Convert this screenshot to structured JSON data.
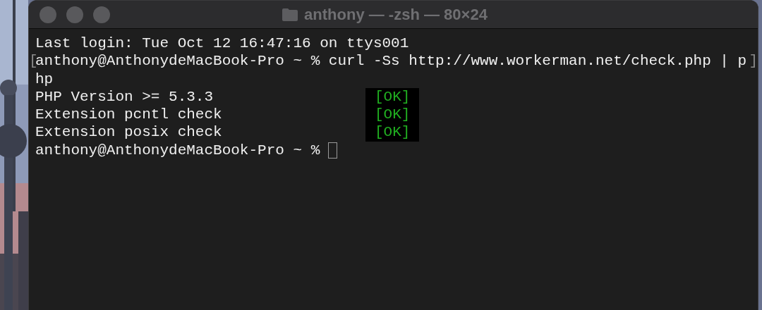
{
  "window": {
    "title": "anthony — -zsh — 80×24"
  },
  "terminal": {
    "lines": [
      {
        "text": "Last login: Tue Oct 12 16:47:16 on ttys001"
      },
      {
        "text": "anthony@AnthonydeMacBook-Pro ~ % curl -Ss http://www.workerman.net/check.php | p",
        "mark_open": "[",
        "mark_close": "]"
      },
      {
        "text": "hp"
      },
      {
        "text": "PHP Version >= 5.3.3",
        "status": "[OK]"
      },
      {
        "text": "Extension pcntl check",
        "status": "[OK]"
      },
      {
        "text": "Extension posix check",
        "status": "[OK]"
      },
      {
        "text": "anthony@AnthonydeMacBook-Pro ~ %",
        "cursor": true
      }
    ]
  }
}
